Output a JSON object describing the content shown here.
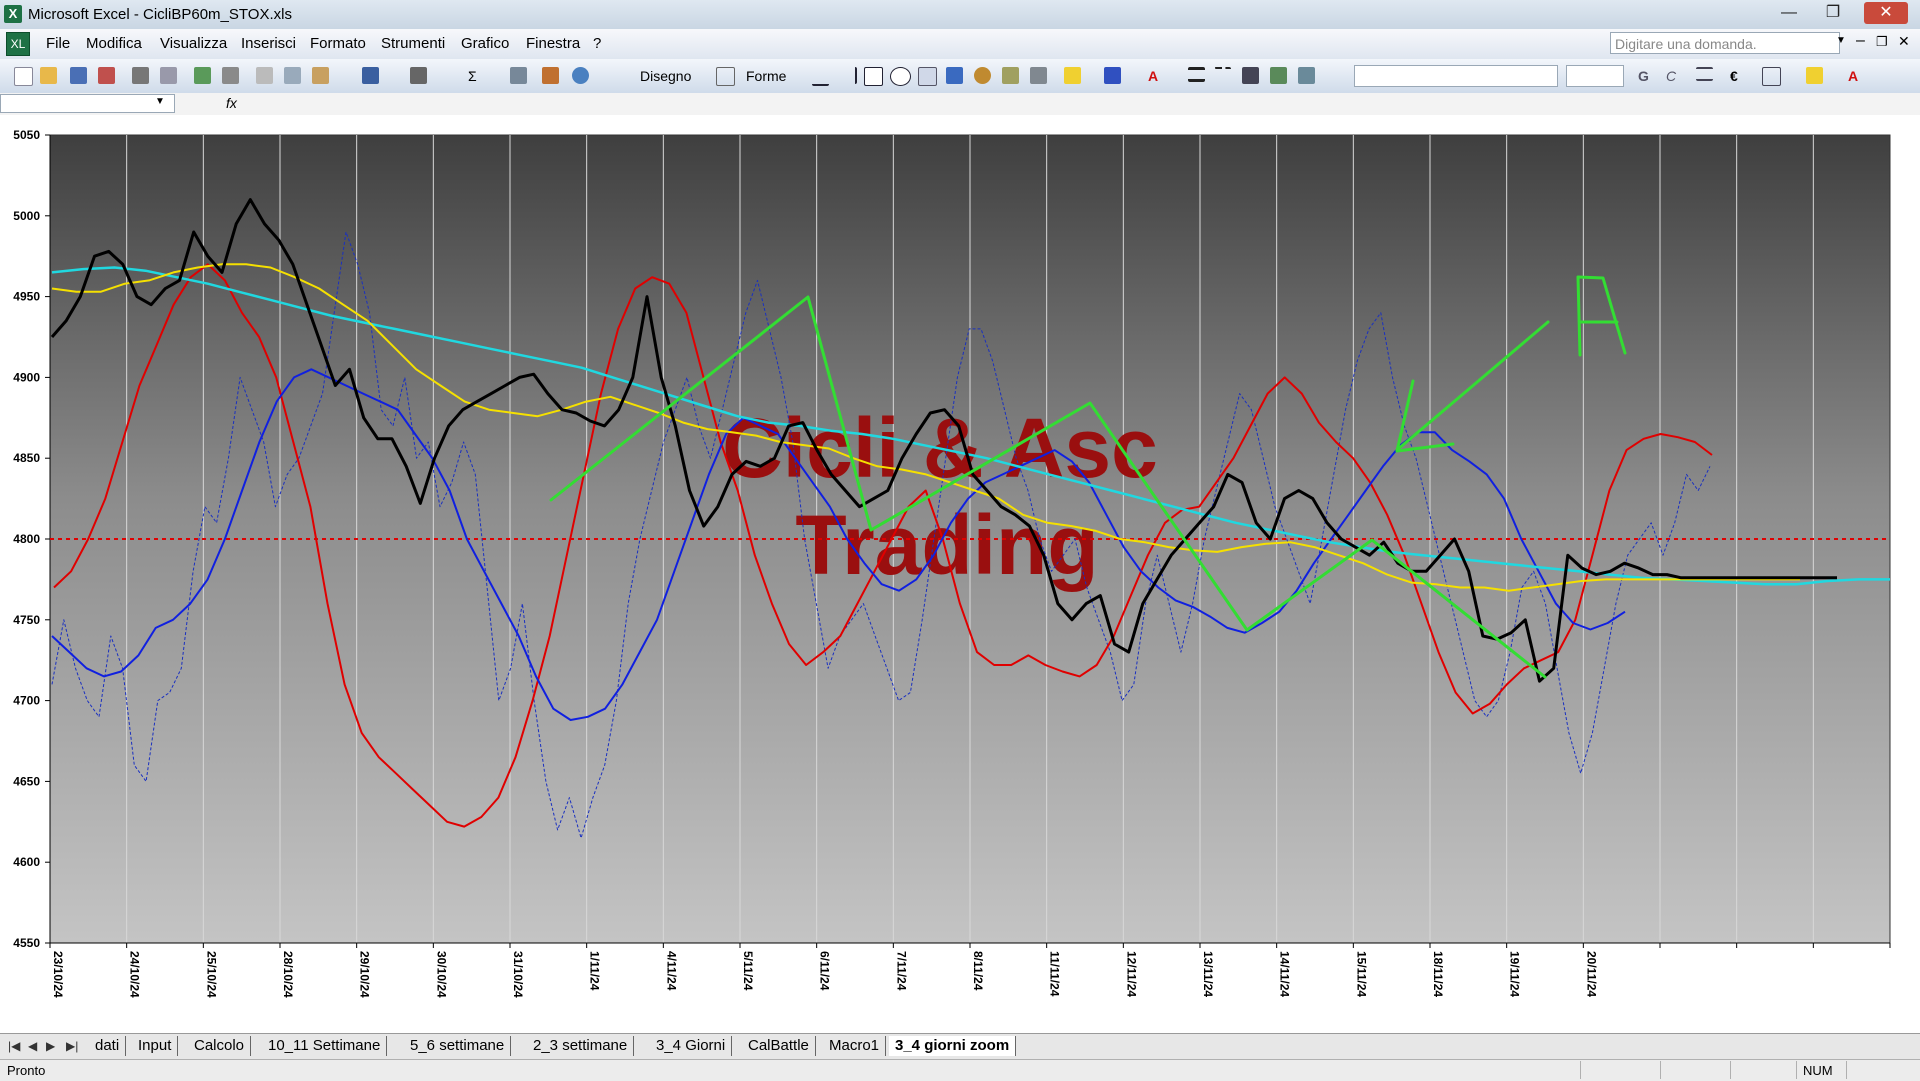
{
  "window": {
    "title": "Microsoft Excel - CicliBP60m_STOX.xls",
    "app_icon": "X",
    "doc_icon": "XL",
    "minimize_glyph": "—",
    "restore_glyph": "❐",
    "close_glyph": "✕",
    "doc_minimize_glyph": "–",
    "doc_restore_glyph": "❐",
    "doc_close_glyph": "✕"
  },
  "menu": {
    "items": [
      {
        "label": "File"
      },
      {
        "label": "Modifica"
      },
      {
        "label": "Visualizza"
      },
      {
        "label": "Inserisci"
      },
      {
        "label": "Formato"
      },
      {
        "label": "Strumenti"
      },
      {
        "label": "Grafico"
      },
      {
        "label": "Finestra"
      },
      {
        "label": "?"
      }
    ],
    "ask_placeholder": "Digitare una domanda."
  },
  "toolbar": {
    "draw_label": "Disegno",
    "shapes_label": "Forme",
    "bold_glyph": "G",
    "italic_glyph": "C",
    "euro_glyph": "€",
    "sigma_glyph": "Σ",
    "font_color_glyph": "A"
  },
  "formula_bar": {
    "fx_label": "fx"
  },
  "colors": {
    "black_line": "#000000",
    "red_line": "#e00000",
    "blue_line": "#1020e0",
    "yellow_line": "#f5e000",
    "cyan_line": "#20d8e0",
    "dotted_blue": "#1a30c0",
    "green_annotation": "#33dd33",
    "watermark": "#9a0f0f",
    "reference_line": "#e00000"
  },
  "chart_data": {
    "type": "line",
    "ylim": [
      4550,
      5050
    ],
    "yticks": [
      4550,
      4600,
      4650,
      4700,
      4750,
      4800,
      4850,
      4900,
      4950,
      5000,
      5050
    ],
    "x_labels": [
      "23/10/24",
      "24/10/24",
      "25/10/24",
      "28/10/24",
      "29/10/24",
      "30/10/24",
      "31/10/24",
      "1/11/24",
      "4/11/24",
      "5/11/24",
      "6/11/24",
      "7/11/24",
      "8/11/24",
      "11/11/24",
      "12/11/24",
      "13/11/24",
      "14/11/24",
      "15/11/24",
      "18/11/24",
      "19/11/24",
      "20/11/24"
    ],
    "reference_line": 4800,
    "watermark": [
      "Cicli & Asc",
      "Trading"
    ],
    "series": [
      {
        "key": "black",
        "values": [
          4925,
          4935,
          4950,
          4975,
          4978,
          4970,
          4950,
          4945,
          4955,
          4960,
          4990,
          4975,
          4965,
          4995,
          5010,
          4995,
          4985,
          4970,
          4945,
          4920,
          4895,
          4905,
          4875,
          4862,
          4862,
          4845,
          4822,
          4850,
          4870,
          4880,
          4885,
          4890,
          4895,
          4900,
          4902,
          4890,
          4880,
          4878,
          4873,
          4870,
          4880,
          4900,
          4950,
          4900,
          4870,
          4830,
          4808,
          4820,
          4840,
          4848,
          4845,
          4850,
          4870,
          4872,
          4855,
          4840,
          4830,
          4820,
          4825,
          4830,
          4850,
          4865,
          4878,
          4880,
          4870,
          4840,
          4830,
          4820,
          4815,
          4808,
          4790,
          4760,
          4750,
          4760,
          4765,
          4735,
          4730,
          4760,
          4775,
          4790,
          4800,
          4810,
          4820,
          4840,
          4835,
          4810,
          4800,
          4825,
          4830,
          4825,
          4810,
          4800,
          4795,
          4790,
          4798,
          4785,
          4780,
          4780,
          4790,
          4800,
          4780,
          4740,
          4738,
          4742,
          4750,
          4712,
          4720,
          4790,
          4782,
          4778,
          4780,
          4785,
          4782,
          4778,
          4778,
          4776,
          4776,
          4776,
          4776,
          4776,
          4776,
          4776,
          4776,
          4776,
          4776,
          4776,
          4776
        ]
      },
      {
        "key": "red",
        "values": [
          4770,
          4780,
          4800,
          4825,
          4860,
          4895,
          4920,
          4945,
          4962,
          4970,
          4960,
          4940,
          4925,
          4900,
          4860,
          4820,
          4760,
          4710,
          4680,
          4665,
          4655,
          4645,
          4635,
          4625,
          4622,
          4628,
          4640,
          4665,
          4700,
          4740,
          4790,
          4840,
          4890,
          4930,
          4955,
          4962,
          4958,
          4940,
          4900,
          4860,
          4830,
          4790,
          4760,
          4735,
          4722,
          4730,
          4740,
          4760,
          4780,
          4800,
          4820,
          4830,
          4800,
          4760,
          4730,
          4722,
          4722,
          4728,
          4722,
          4718,
          4715,
          4722,
          4740,
          4765,
          4790,
          4810,
          4818,
          4820,
          4835,
          4850,
          4870,
          4890,
          4900,
          4890,
          4872,
          4860,
          4850,
          4835,
          4815,
          4790,
          4760,
          4730,
          4705,
          4692,
          4698,
          4710,
          4720,
          4725,
          4730,
          4750,
          4790,
          4830,
          4855,
          4862,
          4865,
          4863,
          4860,
          4852
        ]
      },
      {
        "key": "blue",
        "values": [
          4740,
          4730,
          4720,
          4715,
          4718,
          4728,
          4745,
          4750,
          4760,
          4775,
          4800,
          4830,
          4860,
          4885,
          4900,
          4905,
          4900,
          4895,
          4890,
          4885,
          4880,
          4865,
          4850,
          4830,
          4800,
          4780,
          4760,
          4740,
          4715,
          4695,
          4688,
          4690,
          4695,
          4710,
          4730,
          4750,
          4780,
          4810,
          4840,
          4865,
          4875,
          4870,
          4865,
          4850,
          4835,
          4820,
          4800,
          4785,
          4772,
          4768,
          4775,
          4790,
          4810,
          4825,
          4835,
          4840,
          4845,
          4850,
          4855,
          4848,
          4835,
          4815,
          4795,
          4780,
          4770,
          4762,
          4758,
          4752,
          4745,
          4742,
          4748,
          4755,
          4768,
          4785,
          4800,
          4815,
          4830,
          4845,
          4858,
          4866,
          4866,
          4855,
          4848,
          4840,
          4825,
          4800,
          4780,
          4760,
          4748,
          4744,
          4748,
          4755
        ]
      },
      {
        "key": "yellow",
        "values": [
          4955,
          4953,
          4953,
          4958,
          4960,
          4965,
          4968,
          4970,
          4970,
          4968,
          4962,
          4955,
          4945,
          4935,
          4920,
          4905,
          4895,
          4885,
          4880,
          4878,
          4876,
          4880,
          4885,
          4888,
          4883,
          4878,
          4872,
          4868,
          4866,
          4864,
          4860,
          4858,
          4856,
          4850,
          4845,
          4843,
          4840,
          4835,
          4830,
          4825,
          4815,
          4810,
          4808,
          4805,
          4800,
          4798,
          4795,
          4793,
          4792,
          4795,
          4797,
          4798,
          4795,
          4790,
          4785,
          4778,
          4773,
          4772,
          4770,
          4770,
          4768,
          4770,
          4772,
          4774,
          4775,
          4775,
          4775,
          4775,
          4775,
          4775,
          4775,
          4775,
          4775
        ]
      },
      {
        "key": "cyan",
        "values": [
          4965,
          4967,
          4968,
          4966,
          4962,
          4958,
          4953,
          4948,
          4943,
          4938,
          4934,
          4930,
          4926,
          4922,
          4918,
          4914,
          4910,
          4906,
          4900,
          4894,
          4888,
          4882,
          4876,
          4872,
          4870,
          4867,
          4865,
          4862,
          4858,
          4854,
          4850,
          4845,
          4840,
          4835,
          4830,
          4825,
          4820,
          4815,
          4810,
          4806,
          4802,
          4798,
          4795,
          4792,
          4790,
          4788,
          4786,
          4784,
          4782,
          4780,
          4778,
          4776,
          4775,
          4774,
          4773,
          4772,
          4772,
          4774,
          4775,
          4775
        ]
      },
      {
        "key": "dotted",
        "values": [
          4710,
          4750,
          4720,
          4700,
          4690,
          4740,
          4720,
          4660,
          4650,
          4700,
          4705,
          4720,
          4780,
          4820,
          4810,
          4850,
          4900,
          4880,
          4860,
          4820,
          4840,
          4850,
          4870,
          4890,
          4940,
          4990,
          4970,
          4940,
          4880,
          4870,
          4900,
          4850,
          4860,
          4820,
          4835,
          4860,
          4840,
          4770,
          4700,
          4720,
          4760,
          4700,
          4650,
          4620,
          4640,
          4615,
          4640,
          4660,
          4700,
          4760,
          4800,
          4830,
          4860,
          4880,
          4900,
          4870,
          4850,
          4880,
          4910,
          4940,
          4960,
          4930,
          4900,
          4860,
          4800,
          4760,
          4720,
          4740,
          4750,
          4760,
          4740,
          4720,
          4700,
          4705,
          4750,
          4800,
          4850,
          4900,
          4930,
          4930,
          4910,
          4880,
          4850,
          4830,
          4800,
          4780,
          4790,
          4800,
          4770,
          4750,
          4730,
          4700,
          4710,
          4760,
          4790,
          4760,
          4730,
          4760,
          4800,
          4830,
          4860,
          4890,
          4880,
          4850,
          4820,
          4800,
          4780,
          4760,
          4800,
          4840,
          4880,
          4910,
          4930,
          4940,
          4900,
          4870,
          4850,
          4820,
          4790,
          4760,
          4730,
          4700,
          4690,
          4700,
          4730,
          4770,
          4780,
          4760,
          4720,
          4680,
          4655,
          4680,
          4720,
          4760,
          4790,
          4800,
          4810,
          4790,
          4810,
          4840,
          4830,
          4845
        ]
      }
    ]
  },
  "sheet_tabs": [
    {
      "label": "dati"
    },
    {
      "label": "Input"
    },
    {
      "label": "Calcolo"
    },
    {
      "label": "10_11 Settimane"
    },
    {
      "label": "5_6 settimane"
    },
    {
      "label": "2_3 settimane"
    },
    {
      "label": "3_4 Giorni"
    },
    {
      "label": "CalBattle"
    },
    {
      "label": "Macro1"
    },
    {
      "label": "3_4 giorni zoom",
      "active": true
    }
  ],
  "status": {
    "text": "Pronto",
    "num": "NUM"
  }
}
